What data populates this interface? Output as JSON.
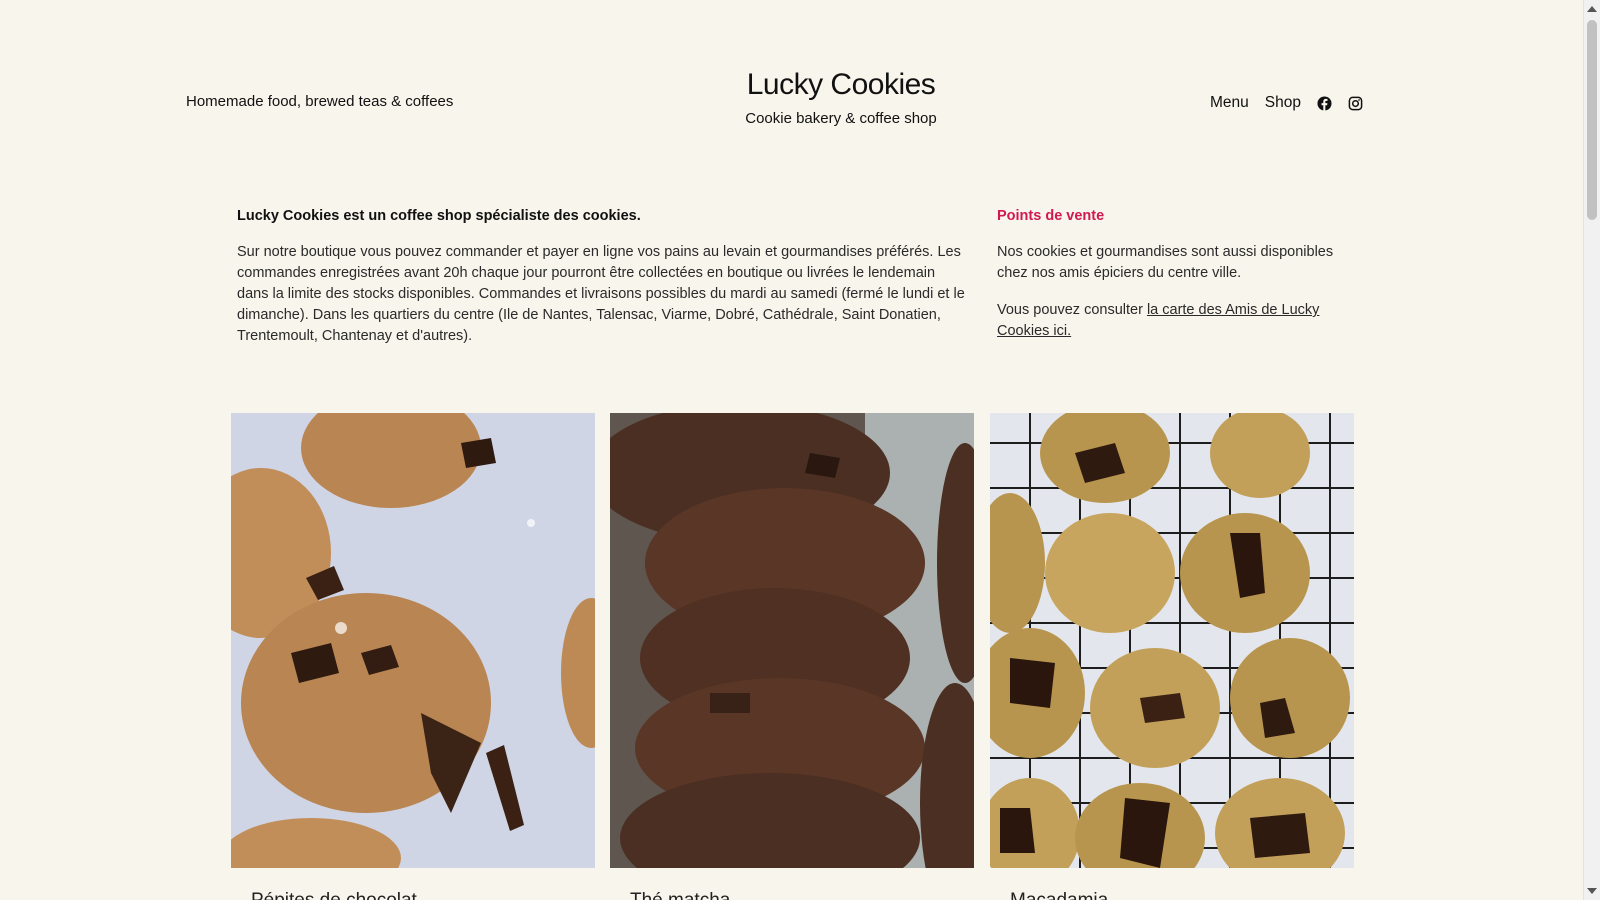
{
  "header": {
    "tagline": "Homemade food, brewed teas & coffees",
    "title": "Lucky Cookies",
    "subtitle": "Cookie bakery & coffee shop",
    "nav": {
      "menu": "Menu",
      "shop": "Shop"
    },
    "icons": [
      "facebook-icon",
      "instagram-icon"
    ]
  },
  "intro": {
    "heading": "Lucky Cookies est un coffee shop spécialiste des cookies.",
    "body": "Sur notre boutique vous pouvez commander et payer en ligne vos pains au levain et gourmandises préférés. Les commandes enregistrées avant 20h chaque jour pourront être collectées en boutique ou livrées le lendemain dans la limite des stocks disponibles. Commandes et livraisons possibles du mardi au samedi (fermé le lundi et le dimanche). Dans les quartiers du centre (Ile de Nantes, Talensac, Viarme, Dobré, Cathédrale, Saint Donatien, Trentemoult, Chantenay et d'autres)."
  },
  "points_de_vente": {
    "heading": "Points de vente",
    "text1": "Nos cookies et gourmandises sont aussi disponibles chez nos amis épiciers du centre ville.",
    "text2_prefix": "Vous pouvez consulter ",
    "link": "la carte des Amis de Lucky Cookies ici."
  },
  "products": [
    {
      "name": "Pépites de chocolat"
    },
    {
      "name": "Thé matcha"
    },
    {
      "name": "Macadamia"
    }
  ],
  "colors": {
    "background": "#f7f5ec",
    "accent": "#d1184f",
    "text": "#1c1c1c"
  }
}
